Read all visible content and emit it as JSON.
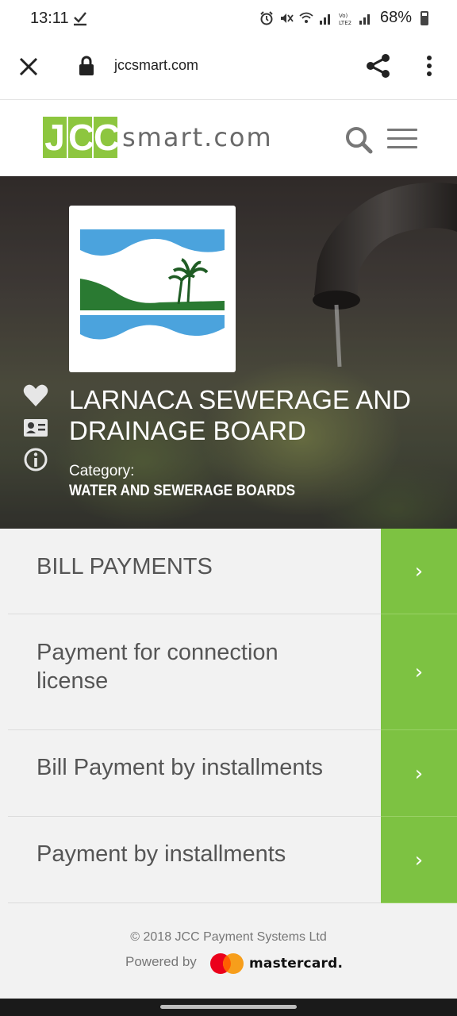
{
  "status_bar": {
    "time": "13:11",
    "battery": "68%",
    "icons": [
      "alarm-icon",
      "mute-icon",
      "wifi-icon",
      "signal-icon",
      "volte-icon",
      "signal-icon",
      "battery-icon"
    ]
  },
  "browser": {
    "url": "jccsmart.com"
  },
  "header": {
    "logo_letters": [
      "J",
      "C",
      "C"
    ],
    "logo_suffix": "smart.com",
    "brand_color": "#8dc63f"
  },
  "hero": {
    "title": "LARNACA SEWERAGE AND DRAINAGE BOARD",
    "category_label": "Category:",
    "category_value": "WATER AND SEWERAGE BOARDS",
    "side_icons": [
      "heart-icon",
      "contact-card-icon",
      "info-icon"
    ]
  },
  "payments": {
    "accent_color": "#7dc242",
    "items": [
      {
        "label": "BILL PAYMENTS"
      },
      {
        "label": "Payment for connection license"
      },
      {
        "label": "Bill Payment by installments"
      },
      {
        "label": "Payment by installments"
      }
    ]
  },
  "footer": {
    "copyright": "© 2018 JCC Payment Systems Ltd",
    "powered_by": "Powered by",
    "card_brand": "mastercard."
  }
}
